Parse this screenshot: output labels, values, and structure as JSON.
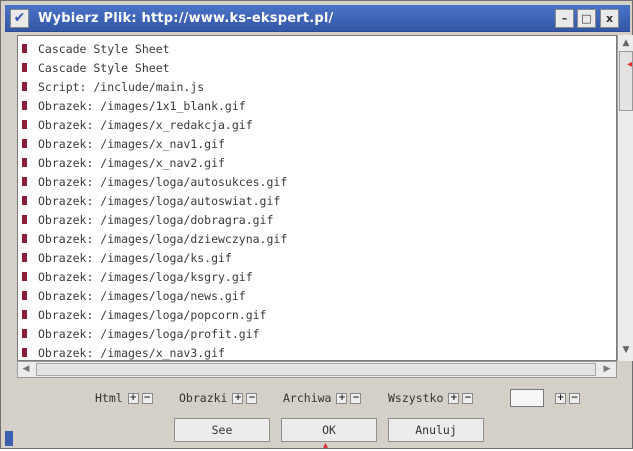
{
  "window": {
    "title": "Wybierz Plik: http://www.ks-ekspert.pl/",
    "menu_glyph": "✔",
    "minimize_glyph": "–",
    "maximize_glyph": "□",
    "close_glyph": "x"
  },
  "files": [
    {
      "label": "Cascade Style Sheet"
    },
    {
      "label": "Cascade Style Sheet"
    },
    {
      "label": "Script: /include/main.js"
    },
    {
      "label": "Obrazek: /images/1x1_blank.gif"
    },
    {
      "label": "Obrazek: /images/x_redakcja.gif"
    },
    {
      "label": "Obrazek: /images/x_nav1.gif"
    },
    {
      "label": "Obrazek: /images/x_nav2.gif"
    },
    {
      "label": "Obrazek: /images/loga/autosukces.gif"
    },
    {
      "label": "Obrazek: /images/loga/autoswiat.gif"
    },
    {
      "label": "Obrazek: /images/loga/dobragra.gif"
    },
    {
      "label": "Obrazek: /images/loga/dziewczyna.gif"
    },
    {
      "label": "Obrazek: /images/loga/ks.gif"
    },
    {
      "label": "Obrazek: /images/loga/ksgry.gif"
    },
    {
      "label": "Obrazek: /images/loga/news.gif"
    },
    {
      "label": "Obrazek: /images/loga/popcorn.gif"
    },
    {
      "label": "Obrazek: /images/loga/profit.gif"
    },
    {
      "label": "Obrazek: /images/x_nav3.gif"
    }
  ],
  "filters": {
    "html": "Html",
    "images": "Obrazki",
    "archives": "Archiwa",
    "all": "Wszystko",
    "plus": "+",
    "minus": "−"
  },
  "buttons": {
    "see": "See",
    "ok": "OK",
    "cancel": "Anuluj"
  },
  "colors": {
    "titlebar": "#3f68bd",
    "bullet": "#8b1f3a",
    "marker": "#e03030"
  }
}
